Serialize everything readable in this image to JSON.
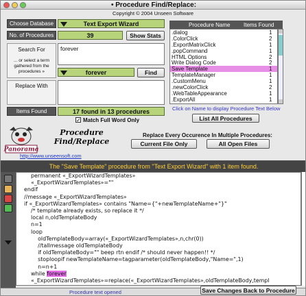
{
  "window": {
    "title": "• Procedure Find/Replace:"
  },
  "copyright": "Copyright © 2004 Unseen Software",
  "labels": {
    "choose_database": "Choose Database",
    "num_procedures": "No. of Procedures",
    "search_for": "Search For",
    "select_term": "... or select a term gathered from the procedures »",
    "replace_with": "Replace With",
    "items_found": "Items Found"
  },
  "database": {
    "selected": "Text Export Wizard"
  },
  "num_procedures": {
    "value": "39"
  },
  "search": {
    "value": "forever"
  },
  "term_select": {
    "selected": "forever"
  },
  "replace": {
    "value": ""
  },
  "items_found": {
    "value": "17 found in 13 procedures"
  },
  "buttons": {
    "show_stats": "Show Stats",
    "find": "Find",
    "list_all": "List All Procedures",
    "current_file": "Current File Only",
    "all_open_files": "All Open Files",
    "save_changes": "Save Changes Back to Procedure"
  },
  "list": {
    "header_name": "Procedure Name",
    "header_count": "Items Found",
    "items": [
      {
        "name": ".dialog",
        "count": "1"
      },
      {
        "name": ".ColorClick",
        "count": "2"
      },
      {
        "name": ".ExportMatrixClick",
        "count": "1"
      },
      {
        "name": ".popCommand",
        "count": "1"
      },
      {
        "name": "HTML Options",
        "count": "2"
      },
      {
        "name": "Write Dialog Code",
        "count": "2"
      },
      {
        "name": "Save Template",
        "count": "1",
        "selected": true
      },
      {
        "name": "TemplateManager",
        "count": "1"
      },
      {
        "name": ".CustomMenu",
        "count": "1"
      },
      {
        "name": ".newColorClick",
        "count": "2"
      },
      {
        "name": ".WebTableAppearance",
        "count": "1"
      },
      {
        "name": ".ExportAll",
        "count": "1"
      }
    ]
  },
  "hint": "Click on Name to display Procedure Text Below",
  "checkbox": {
    "label": "Match Full Word Only",
    "checked": true
  },
  "logo": {
    "text": "Panorama"
  },
  "product": {
    "line1": "Procedure",
    "line2": "Find/Replace",
    "url": "http://www.unseensoft.com"
  },
  "replace_scope_label": "Replace Every Occurence In Multiple Procedures:",
  "banner": "The \"Save Template\" procedure from \"Text Export Wizard\"  with 1 item found.",
  "code_lines": [
    {
      "pre": "      permanent «_ExportWizardTemplates»",
      "hl": "",
      "post": ""
    },
    {
      "pre": "      «_ExportWizardTemplates»=\"\"",
      "hl": "",
      "post": ""
    },
    {
      "pre": "  endif",
      "hl": "",
      "post": ""
    },
    {
      "pre": "  //message «_ExportWizardTemplates»",
      "hl": "",
      "post": ""
    },
    {
      "pre": "  if «_ExportWizardTemplates» contains \"Name={\"+newTemplateName+\"}\"",
      "hl": "",
      "post": ""
    },
    {
      "pre": "      /* template already exists, so replace it */",
      "hl": "",
      "post": ""
    },
    {
      "pre": "      local n,oldTemplateBody",
      "hl": "",
      "post": ""
    },
    {
      "pre": "      n=1",
      "hl": "",
      "post": ""
    },
    {
      "pre": "      loop",
      "hl": "",
      "post": ""
    },
    {
      "pre": "          oldTemplateBody=array(«_ExportWizardTemplates»,n,chr(0))",
      "hl": "",
      "post": ""
    },
    {
      "pre": "          //tallmessage oldTemplateBody",
      "hl": "",
      "post": ""
    },
    {
      "pre": "          if oldTemplateBody=\"\" beep rtn endif /* should never happen!! */",
      "hl": "",
      "post": ""
    },
    {
      "pre": "          stoploopif newTemplateName=tagparameter(oldTemplateBody,\"Name=\",1)",
      "hl": "",
      "post": ""
    },
    {
      "pre": "          n=n+1",
      "hl": "",
      "post": ""
    },
    {
      "pre": "      while ",
      "hl": "forever",
      "post": ""
    },
    {
      "pre": "      «_ExportWizardTemplates»=replace(«_ExportWizardTemplates»,oldTemplateBody,templ",
      "hl": "",
      "post": ""
    },
    {
      "pre": "  ateBody)",
      "hl": "",
      "post": ""
    },
    {
      "pre": "  else",
      "hl": "",
      "post": ""
    }
  ],
  "status": "Procedure text opened",
  "colors": {
    "highlight": "#e36ee8",
    "green_field": "#b7d47a",
    "banner_text": "#ffcf3a"
  }
}
